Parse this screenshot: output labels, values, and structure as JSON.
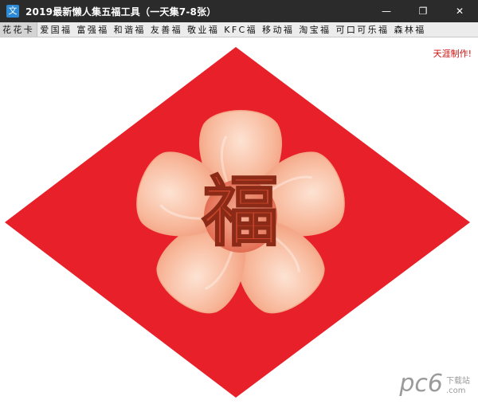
{
  "window": {
    "title": "2019最新懒人集五福工具（一天集7-8张）",
    "controls": {
      "minimize": "—",
      "maximize": "❐",
      "close": "✕"
    }
  },
  "tabs": [
    {
      "label": "花花卡",
      "active": true
    },
    {
      "label": "爱国福",
      "active": false
    },
    {
      "label": "富强福",
      "active": false
    },
    {
      "label": "和谐福",
      "active": false
    },
    {
      "label": "友善福",
      "active": false
    },
    {
      "label": "敬业福",
      "active": false
    },
    {
      "label": "KFC福",
      "active": false
    },
    {
      "label": "移动福",
      "active": false
    },
    {
      "label": "淘宝福",
      "active": false
    },
    {
      "label": "可口可乐福",
      "active": false
    },
    {
      "label": "森林福",
      "active": false
    }
  ],
  "content": {
    "author_note": "天涯制作!",
    "card_character": "福",
    "card_color": "#e8202a"
  },
  "watermark": {
    "main": "pc6",
    "sub": "下载站",
    "domain": ".com"
  }
}
